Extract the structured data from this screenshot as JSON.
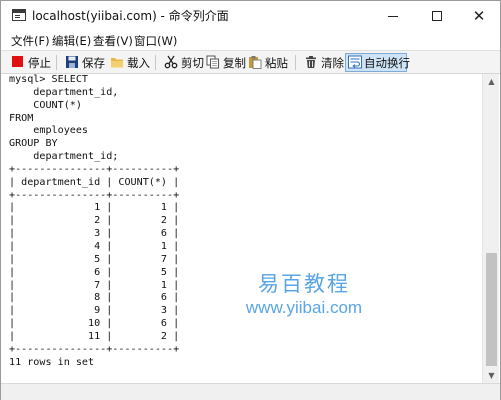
{
  "window": {
    "title": "localhost(yiibai.com) - 命令列介面",
    "controls": {
      "minimize": "─",
      "maximize": "☐",
      "close": "✕"
    }
  },
  "menubar": {
    "items": [
      {
        "label": "文件(F)"
      },
      {
        "label": "编辑(E)"
      },
      {
        "label": "查看(V)"
      },
      {
        "label": "窗口(W)"
      }
    ]
  },
  "toolbar": {
    "buttons": [
      {
        "label": "停止",
        "icon": "stop-icon",
        "color": "#e01010"
      },
      {
        "label": "保存",
        "icon": "save-icon",
        "color": "#1f3f7a"
      },
      {
        "label": "载入",
        "icon": "folder-icon",
        "color": "#e8b84a"
      },
      {
        "label": "剪切",
        "icon": "scissors-icon",
        "color": "#222222"
      },
      {
        "label": "复制",
        "icon": "copy-icon",
        "color": "#555555"
      },
      {
        "label": "粘贴",
        "icon": "paste-icon",
        "color": "#c89a3a"
      },
      {
        "label": "清除",
        "icon": "trash-icon",
        "color": "#444444"
      },
      {
        "label": "自动换行",
        "icon": "wrap-icon",
        "color": "#2f6fbf",
        "active": true
      }
    ]
  },
  "console": {
    "lines": [
      "mysql> SELECT",
      "    department_id,",
      "    COUNT(*)",
      "FROM",
      "    employees",
      "GROUP BY",
      "    department_id;",
      "+---------------+----------+",
      "| department_id | COUNT(*) |",
      "+---------------+----------+",
      "|             1 |        1 |",
      "|             2 |        2 |",
      "|             3 |        6 |",
      "|             4 |        1 |",
      "|             5 |        7 |",
      "|             6 |        5 |",
      "|             7 |        1 |",
      "|             8 |        6 |",
      "|             9 |        3 |",
      "|            10 |        6 |",
      "|            11 |        2 |",
      "+---------------+----------+",
      "11 rows in set"
    ],
    "result_table": {
      "columns": [
        "department_id",
        "COUNT(*)"
      ],
      "rows": [
        [
          1,
          1
        ],
        [
          2,
          2
        ],
        [
          3,
          6
        ],
        [
          4,
          1
        ],
        [
          5,
          7
        ],
        [
          6,
          5
        ],
        [
          7,
          1
        ],
        [
          8,
          6
        ],
        [
          9,
          3
        ],
        [
          10,
          6
        ],
        [
          11,
          2
        ]
      ],
      "summary": "11 rows in set"
    }
  },
  "watermark": {
    "chinese": "易百教程",
    "url": "www.yiibai.com",
    "color": "#5aa5e6"
  }
}
